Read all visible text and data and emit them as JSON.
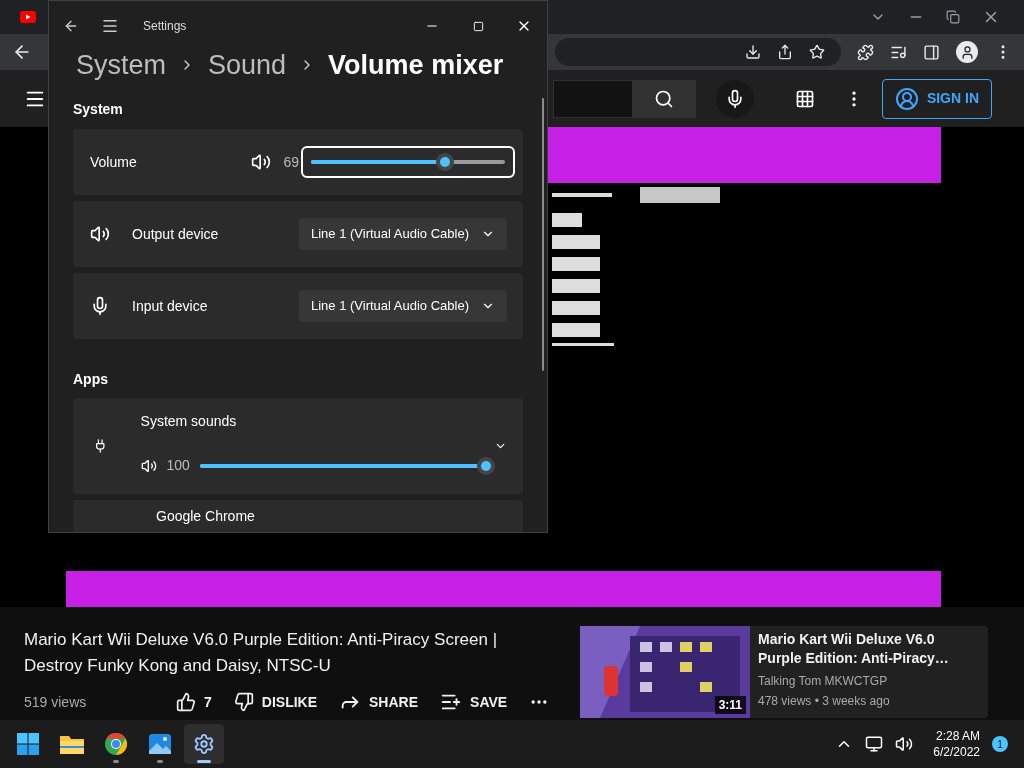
{
  "settings": {
    "title": "Settings",
    "breadcrumb": [
      "System",
      "Sound",
      "Volume mixer"
    ],
    "system_heading": "System",
    "volume": {
      "label": "Volume",
      "reading": "69",
      "level": 0.69,
      "focused": true
    },
    "devices": [
      {
        "kind": "output",
        "label": "Output device",
        "value": "Line 1 (Virtual Audio Cable)"
      },
      {
        "kind": "input",
        "label": "Input device",
        "value": "Line 1 (Virtual Audio Cable)"
      }
    ],
    "apps_heading": "Apps",
    "apps": [
      {
        "kind": "slider",
        "name": "System sounds",
        "reading": "100",
        "level": 1
      },
      {
        "kind": "collapsed",
        "name": "Google Chrome"
      }
    ]
  },
  "youtube": {
    "sign_in": "SIGN IN",
    "video": {
      "title": "Mario Kart Wii Deluxe V6.0 Purple Edition: Anti-Piracy Screen | Destroy Funky Kong and Daisy, NTSC-U",
      "views": "519 views",
      "actions": [
        {
          "kind": "like",
          "label": "7"
        },
        {
          "kind": "dislike",
          "label": "DISLIKE"
        },
        {
          "kind": "share",
          "label": "SHARE"
        },
        {
          "kind": "save",
          "label": "SAVE"
        }
      ]
    },
    "recommended": [
      {
        "title": "Mario Kart Wii Deluxe V6.0 Purple Edition: Anti-Piracy…",
        "channel": "Talking Tom MKWCTGP",
        "meta": "478 views • 3 weeks ago",
        "duration": "3:11"
      }
    ]
  },
  "taskbar": {
    "apps": [
      {
        "kind": "start",
        "running": false,
        "active": false
      },
      {
        "kind": "files",
        "running": false,
        "active": false
      },
      {
        "kind": "chrome",
        "running": true,
        "active": false
      },
      {
        "kind": "photos",
        "running": true,
        "active": false
      },
      {
        "kind": "settings",
        "running": true,
        "active": true
      }
    ],
    "time": "2:28 AM",
    "date": "6/2/2022",
    "notifications": "1"
  }
}
